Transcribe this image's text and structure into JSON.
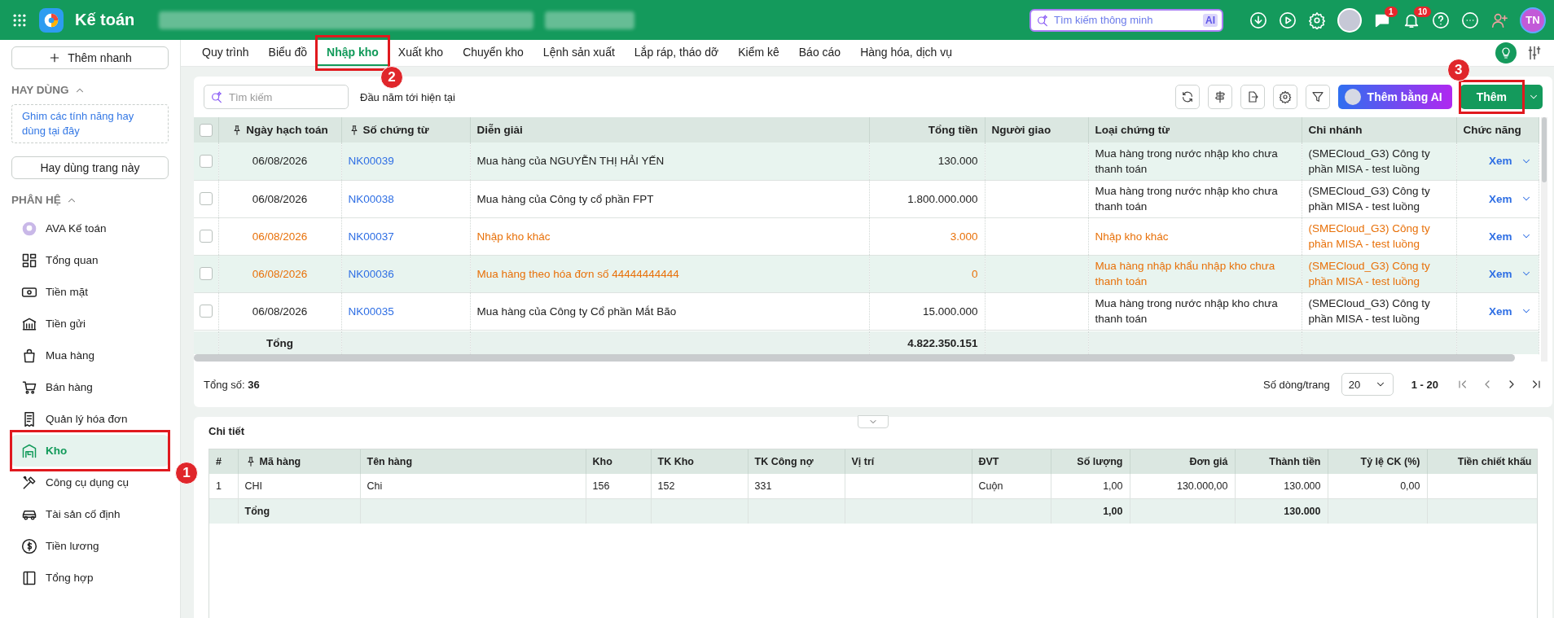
{
  "topbar": {
    "app_title": "Kế toán",
    "search": {
      "placeholder": "Tìm kiếm thông minh",
      "badge": "AI"
    },
    "chat_badge": "1",
    "notification_badge": "10",
    "avatar_initials": "TN"
  },
  "sidebar": {
    "quick_add": "Thêm nhanh",
    "favorites": {
      "title": "HAY DÙNG",
      "expanded": true,
      "hint": "Ghim các tính năng hay dùng tại đây",
      "button": "Hay dùng trang này"
    },
    "modules": {
      "title": "PHÂN HỆ",
      "expanded": true,
      "items": [
        {
          "label": "AVA Kế toán",
          "selected": false
        },
        {
          "label": "Tổng quan",
          "selected": false
        },
        {
          "label": "Tiền mặt",
          "selected": false
        },
        {
          "label": "Tiền gửi",
          "selected": false
        },
        {
          "label": "Mua hàng",
          "selected": false
        },
        {
          "label": "Bán hàng",
          "selected": false
        },
        {
          "label": "Quản lý hóa đơn",
          "selected": false
        },
        {
          "label": "Kho",
          "selected": true,
          "callout": "1"
        },
        {
          "label": "Công cụ dụng cụ",
          "selected": false
        },
        {
          "label": "Tài sản cố định",
          "selected": false
        },
        {
          "label": "Tiền lương",
          "selected": false
        },
        {
          "label": "Tổng hợp",
          "selected": false
        }
      ]
    }
  },
  "tabs": [
    {
      "label": "Quy trình",
      "selected": false
    },
    {
      "label": "Biểu đồ",
      "selected": false
    },
    {
      "label": "Nhập kho",
      "selected": true,
      "callout": "2"
    },
    {
      "label": "Xuất kho",
      "selected": false
    },
    {
      "label": "Chuyển kho",
      "selected": false
    },
    {
      "label": "Lệnh sản xuất",
      "selected": false
    },
    {
      "label": "Lắp ráp, tháo dỡ",
      "selected": false
    },
    {
      "label": "Kiểm kê",
      "selected": false
    },
    {
      "label": "Báo cáo",
      "selected": false
    },
    {
      "label": "Hàng hóa, dịch vụ",
      "selected": false
    }
  ],
  "toolbar": {
    "search": {
      "placeholder": "Tìm kiếm"
    },
    "period": "Đầu năm tới hiện tại",
    "ai_button": "Thêm bằng AI",
    "add_button": {
      "label": "Thêm",
      "callout": "3"
    }
  },
  "table": {
    "all_selected": false,
    "columns": [
      {
        "label": "Ngày hạch toán",
        "pinned": true
      },
      {
        "label": "Số chứng từ",
        "pinned": true
      },
      {
        "label": "Diễn giải",
        "pinned": false
      },
      {
        "label": "Tổng tiền",
        "pinned": false
      },
      {
        "label": "Người giao",
        "pinned": false
      },
      {
        "label": "Loại chứng từ",
        "pinned": false
      },
      {
        "label": "Chi nhánh",
        "pinned": false
      },
      {
        "label": "Chức năng",
        "pinned": false
      }
    ],
    "rows": [
      {
        "checked": false,
        "highlighted": true,
        "color": "#222222",
        "date": "06/08/2026",
        "number": "NK00039",
        "description": "Mua hàng của NGUYỄN THỊ HẢI YẾN",
        "total": "130.000",
        "type_lines": [
          "Mua hàng trong nước nhập kho chưa",
          "thanh toán"
        ],
        "branch_lines": [
          "(SMECloud_G3) Công ty",
          "phần MISA - test luồng"
        ],
        "action": "Xem"
      },
      {
        "checked": false,
        "highlighted": false,
        "color": "#222222",
        "date": "06/08/2026",
        "number": "NK00038",
        "description": "Mua hàng của Công ty cổ phần FPT",
        "total": "1.800.000.000",
        "type_lines": [
          "Mua hàng trong nước nhập kho chưa",
          "thanh toán"
        ],
        "branch_lines": [
          "(SMECloud_G3) Công ty",
          "phần MISA - test luồng"
        ],
        "action": "Xem"
      },
      {
        "checked": false,
        "highlighted": false,
        "color": "#e8710a",
        "date": "06/08/2026",
        "number": "NK00037",
        "description": "Nhập kho khác",
        "total": "3.000",
        "type_lines": [
          "Nhập kho khác"
        ],
        "branch_lines": [
          "(SMECloud_G3) Công ty",
          "phần MISA - test luồng"
        ],
        "action": "Xem"
      },
      {
        "checked": false,
        "highlighted": true,
        "color": "#e8710a",
        "date": "06/08/2026",
        "number": "NK00036",
        "description": "Mua hàng theo hóa đơn số 44444444444",
        "total": "0",
        "type_lines": [
          "Mua hàng nhập khẩu nhập kho chưa",
          "thanh toán"
        ],
        "branch_lines": [
          "(SMECloud_G3) Công ty",
          "phần MISA - test luồng"
        ],
        "action": "Xem"
      },
      {
        "checked": false,
        "highlighted": false,
        "color": "#222222",
        "date": "06/08/2026",
        "number": "NK00035",
        "description": "Mua hàng của Công ty Cổ phần Mắt Bão",
        "total": "15.000.000",
        "type_lines": [
          "Mua hàng trong nước nhập kho chưa",
          "thanh toán"
        ],
        "branch_lines": [
          "(SMECloud_G3) Công ty",
          "phần MISA - test luồng"
        ],
        "action": "Xem"
      }
    ],
    "total_row": {
      "label": "Tổng",
      "total": "4.822.350.151"
    }
  },
  "footer": {
    "count_label": "Tổng số:",
    "count": "36",
    "rows_per_page_label": "Số dòng/trang",
    "rows_per_page": "20",
    "range": "1 - 20"
  },
  "detail": {
    "title": "Chi tiết",
    "columns": [
      {
        "label": "#",
        "pinned": false
      },
      {
        "label": "Mã hàng",
        "pinned": true
      },
      {
        "label": "Tên hàng",
        "pinned": false
      },
      {
        "label": "Kho",
        "pinned": false
      },
      {
        "label": "TK Kho",
        "pinned": false
      },
      {
        "label": "TK Công nợ",
        "pinned": false
      },
      {
        "label": "Vị trí",
        "pinned": false
      },
      {
        "label": "ĐVT",
        "pinned": false
      },
      {
        "label": "Số lượng",
        "pinned": false
      },
      {
        "label": "Đơn giá",
        "pinned": false
      },
      {
        "label": "Thành tiền",
        "pinned": false
      },
      {
        "label": "Tỷ lệ CK (%)",
        "pinned": false
      },
      {
        "label": "Tiền chiết khấu",
        "pinned": false
      }
    ],
    "rows": [
      {
        "no": "1",
        "code": "CHI",
        "name": "Chi",
        "warehouse": "156",
        "stock_account": "152",
        "payable_account": "331",
        "unit": "Cuộn",
        "quantity": "1,00",
        "unit_price": "130.000,00",
        "amount": "130.000",
        "discount_rate": "0,00"
      }
    ],
    "total_row": {
      "label": "Tổng",
      "quantity": "1,00",
      "amount": "130.000"
    }
  }
}
